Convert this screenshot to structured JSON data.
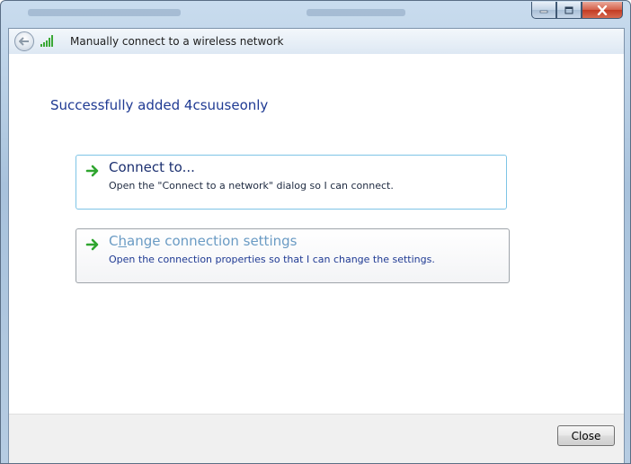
{
  "nav": {
    "title": "Manually connect to a wireless network"
  },
  "main": {
    "heading": "Successfully added 4csuuseonly"
  },
  "options": [
    {
      "title": "Connect to...",
      "description": "Open the \"Connect to a network\" dialog so I can connect."
    },
    {
      "title_prefix": "C",
      "title_access_key": "h",
      "title_rest": "ange connection settings",
      "description": "Open the connection properties so that I can change the settings."
    }
  ],
  "footer": {
    "close_label": "Close"
  },
  "colors": {
    "heading": "#1f3a93",
    "arrow": "#2fa52f",
    "close_button_glow": "#c23a22"
  },
  "icons": {
    "back": "back-arrow-icon",
    "signal": "wireless-signal-icon",
    "arrow": "green-arrow-icon"
  }
}
